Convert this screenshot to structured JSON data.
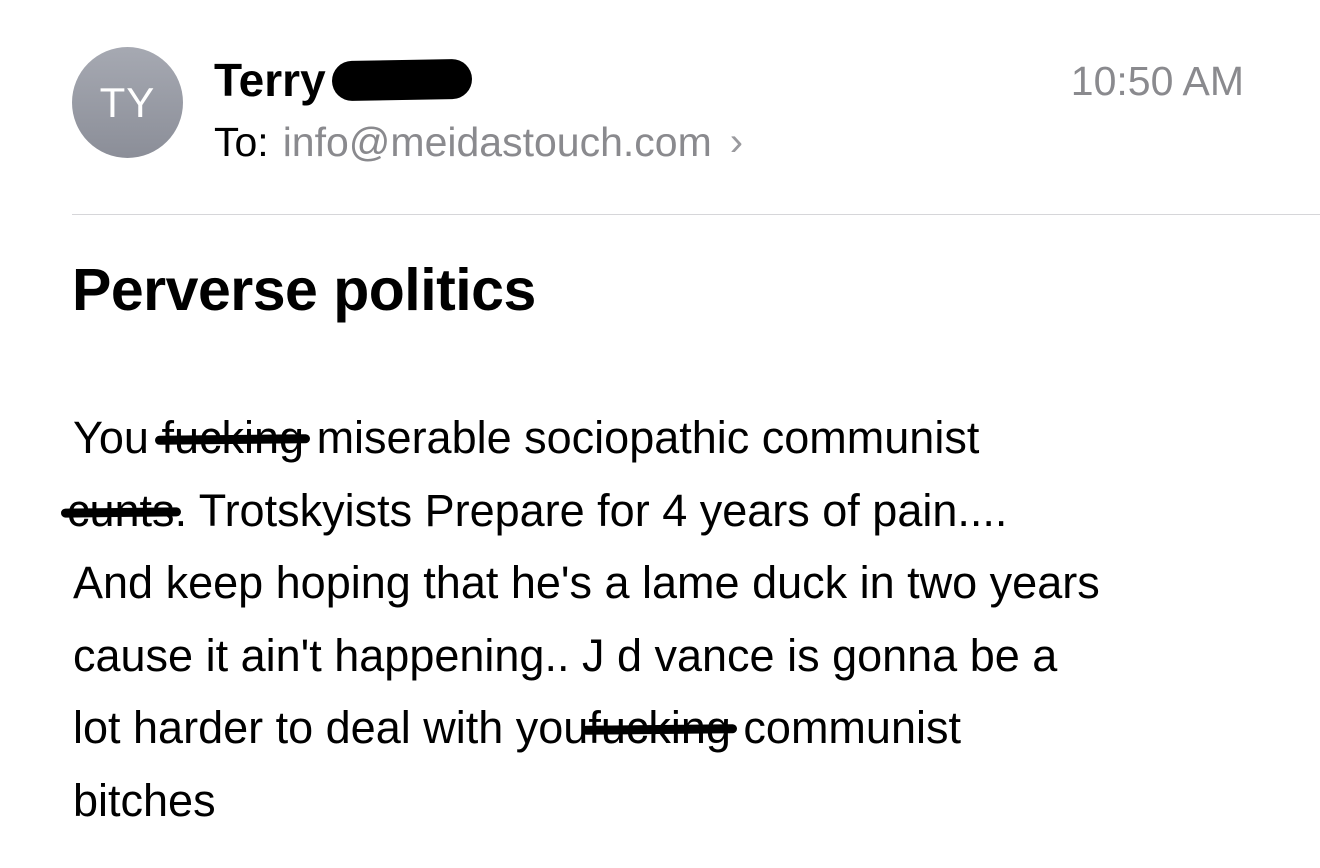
{
  "header": {
    "avatar_initials": "TY",
    "sender_first_name": "Terry",
    "timestamp": "10:50 AM",
    "to_label": "To:",
    "to_address": "info@meidastouch.com",
    "chevron": "›"
  },
  "subject": "Perverse politics",
  "body": {
    "line1_a": "You",
    "line1_redacted": "fucking",
    "line1_b": "miserable sociopathic communist",
    "line2_redacted": "cunts",
    "line2_b": ".  Trotskyists Prepare for 4 years of pain....",
    "line3": "And keep hoping that he's a lame duck in two years",
    "line4": "cause it ain't happening.. J d vance is gonna be a",
    "line5_a": "lot harder to deal with you",
    "line5_redacted": "fucking",
    "line5_b": "communist",
    "line6": "bitches"
  },
  "colors": {
    "secondary_text": "#8a8a8e",
    "avatar_bg": "#9a9da6",
    "divider": "#d6d6d9"
  },
  "icons": {
    "chevron": "chevron-right-icon"
  }
}
